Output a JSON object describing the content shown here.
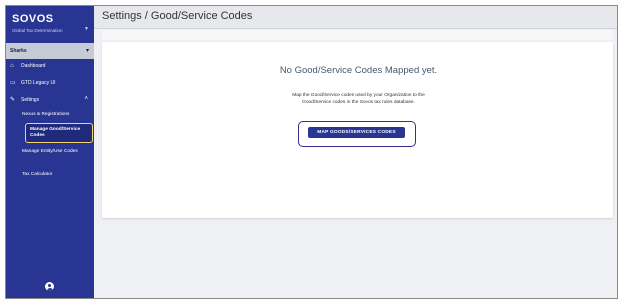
{
  "brand": {
    "name": "SOVOS",
    "product": "Global Tax Determination"
  },
  "org_select": {
    "value": "Sharks"
  },
  "nav": {
    "dashboard": "Dashboard",
    "legacy": "GTD Legacy UI",
    "settings": "Settings",
    "sub_items": [
      "Nexus & Registrations",
      "Manage Good/Service Codes",
      "Manage Entity/Use Codes",
      "Tax Calculator"
    ]
  },
  "header": {
    "title": "Settings / Good/Service Codes"
  },
  "empty_state": {
    "title": "No Good/Service Codes Mapped yet.",
    "description": "Map the Good/Service codes used by your Organization to the Good/Service codes in the Sovos tax rules database.",
    "button_label": "MAP GOODS/SERVICES CODES"
  },
  "colors": {
    "sidebar": "#283593",
    "accent_button": "#283593",
    "active_highlight": "#f5d76e",
    "cta_highlight": "#3c2e8f"
  },
  "icons": [
    "home-icon",
    "window-icon",
    "wrench-icon",
    "chevron-up-icon",
    "chevron-down-icon",
    "account-icon"
  ]
}
